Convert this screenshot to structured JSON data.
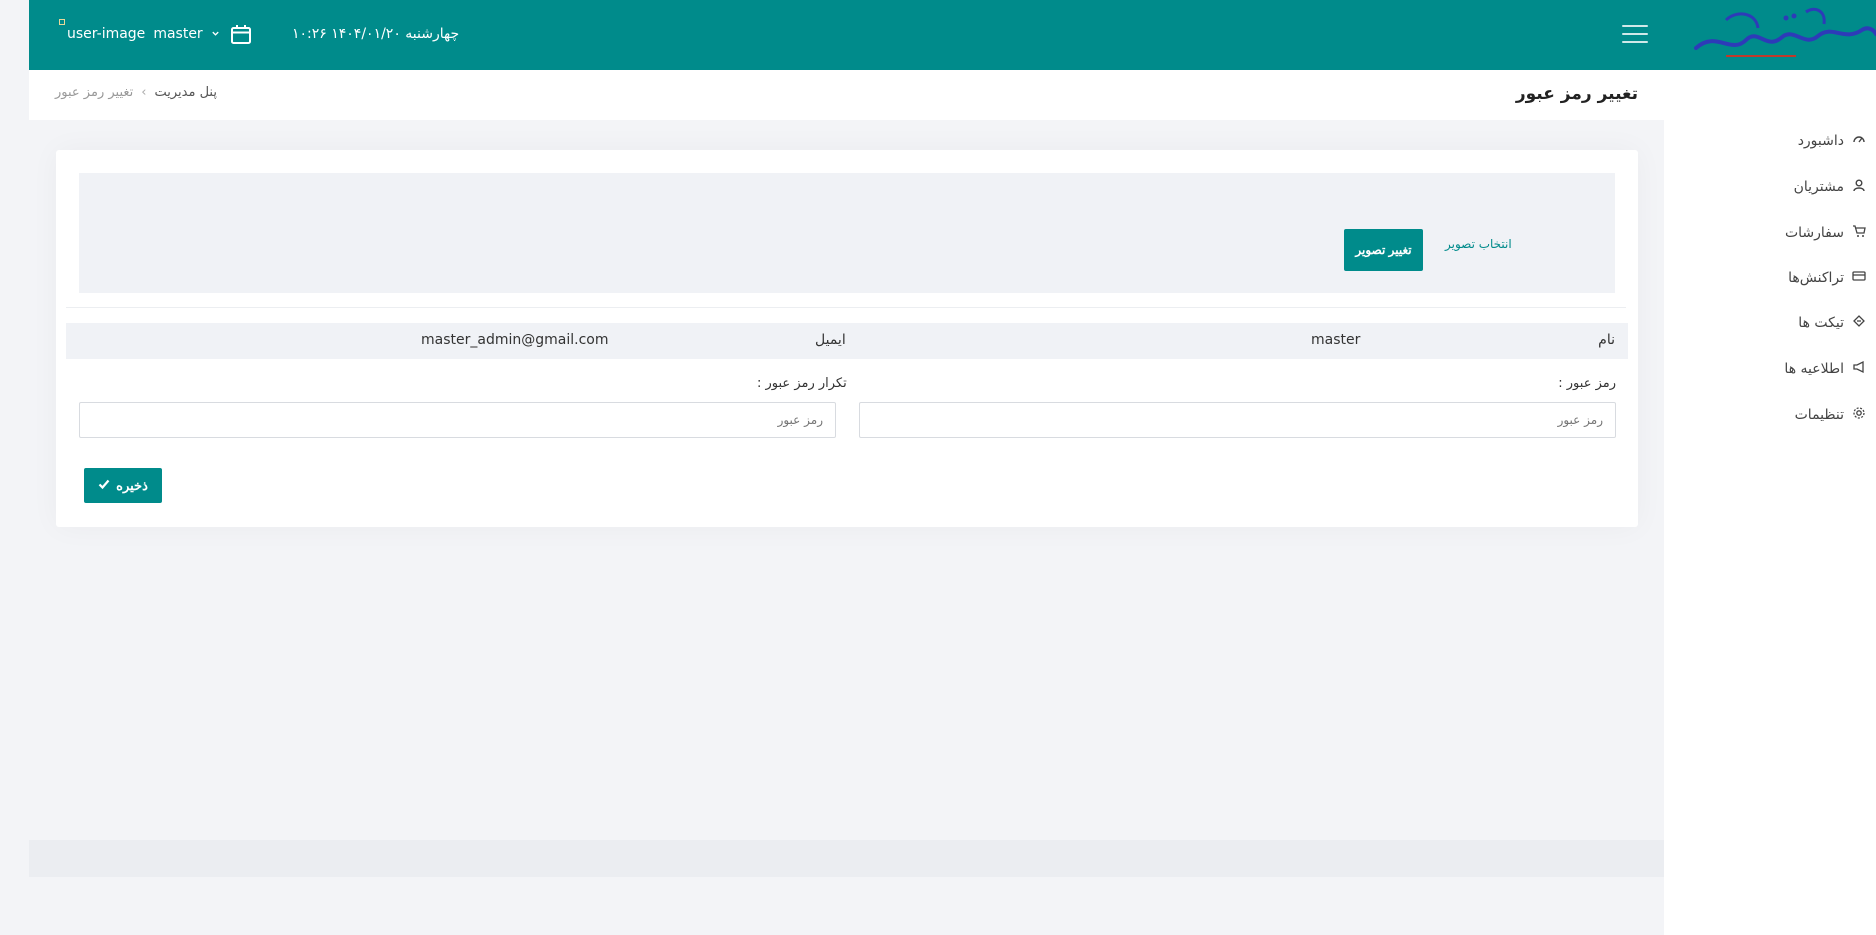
{
  "header": {
    "user_image_alt": "user-image",
    "user_name": "master",
    "datetime": "چهارشنبه ۱۴۰۴/۰۱/۲۰ ۱۰:۲۶"
  },
  "breadcrumb": {
    "page_title": "تغییر رمز عبور",
    "root": "پنل مدیریت",
    "separator": "›",
    "current": "تغییر رمز عبور"
  },
  "sidebar": {
    "items": [
      {
        "label": "داشبورد",
        "icon": "gauge-icon"
      },
      {
        "label": "مشتریان",
        "icon": "user-icon"
      },
      {
        "label": "سفارشات",
        "icon": "cart-icon"
      },
      {
        "label": "تراکنش‌ها",
        "icon": "credit-card-icon"
      },
      {
        "label": "تیکت ها",
        "icon": "ticket-icon"
      },
      {
        "label": "اطلاعیه ها",
        "icon": "megaphone-icon"
      },
      {
        "label": "تنظیمات",
        "icon": "gear-icon"
      }
    ]
  },
  "form": {
    "select_image": "انتخاب تصویر",
    "change_image": "تغییر تصویر",
    "name_label": "نام",
    "name_value": "master",
    "email_label": "ایمیل",
    "email_value": "master_admin@gmail.com",
    "password_label": "رمز عبور :",
    "password_placeholder": "رمز عبور",
    "confirm_label": "تکرار رمز عبور :",
    "confirm_placeholder": "رمز عبور",
    "save": "ذخیره"
  },
  "colors": {
    "primary": "#008b8b",
    "background": "#f3f4f7"
  }
}
